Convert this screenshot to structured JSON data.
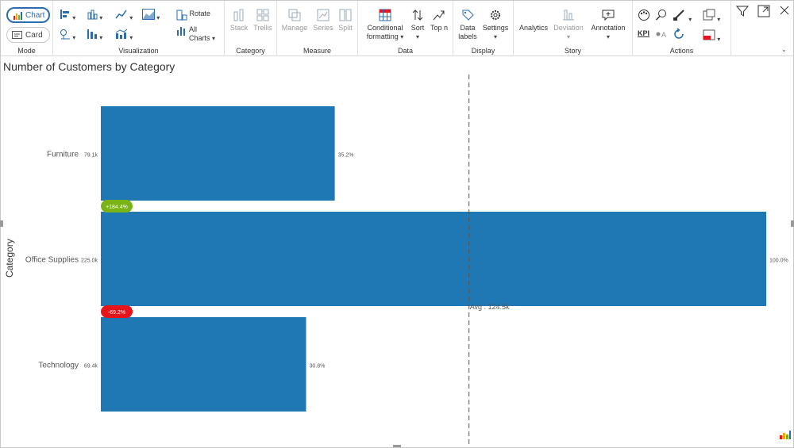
{
  "ribbon": {
    "mode": {
      "label": "Mode",
      "chart": "Chart",
      "card": "Card"
    },
    "visualization": {
      "label": "Visualization",
      "rotate": "Rotate",
      "all_charts_1": "All",
      "all_charts_2": "Charts"
    },
    "category": {
      "label": "Category",
      "stack": "Stack",
      "trellis": "Trellis"
    },
    "measure": {
      "label": "Measure",
      "manage": "Manage",
      "series": "Series",
      "split": "Split"
    },
    "data": {
      "label": "Data",
      "conditional_1": "Conditional",
      "conditional_2": "formatting",
      "sort": "Sort",
      "topn": "Top n"
    },
    "display": {
      "label": "Display",
      "data_labels_1": "Data",
      "data_labels_2": "labels",
      "settings": "Settings"
    },
    "story": {
      "label": "Story",
      "analytics": "Analytics",
      "deviation": "Deviation",
      "annotation": "Annotation"
    },
    "actions": {
      "label": "Actions",
      "kpi": "KPI"
    }
  },
  "colors": {
    "bar": "#1f77b4",
    "positive_badge": "#7ab317",
    "negative_badge": "#e8141c",
    "accent": "#2b6cb0"
  },
  "chart_data": {
    "type": "bar",
    "orientation": "horizontal",
    "title": "Number of Customers by Category",
    "ylabel": "Category",
    "categories": [
      "Furniture",
      "Office Supplies",
      "Technology"
    ],
    "values": [
      79100,
      225000,
      69400
    ],
    "value_labels": [
      "79.1k",
      "225.0k",
      "69.4k"
    ],
    "percent_labels": [
      "35.2%",
      "100.0%",
      "30.8%"
    ],
    "deviation_labels": [
      "+184.4%",
      "-69.2%"
    ],
    "xlim": [
      0,
      225000
    ],
    "average": {
      "value": 124500,
      "label": "Avg : 124.5k"
    },
    "grid": false,
    "legend": "none"
  }
}
